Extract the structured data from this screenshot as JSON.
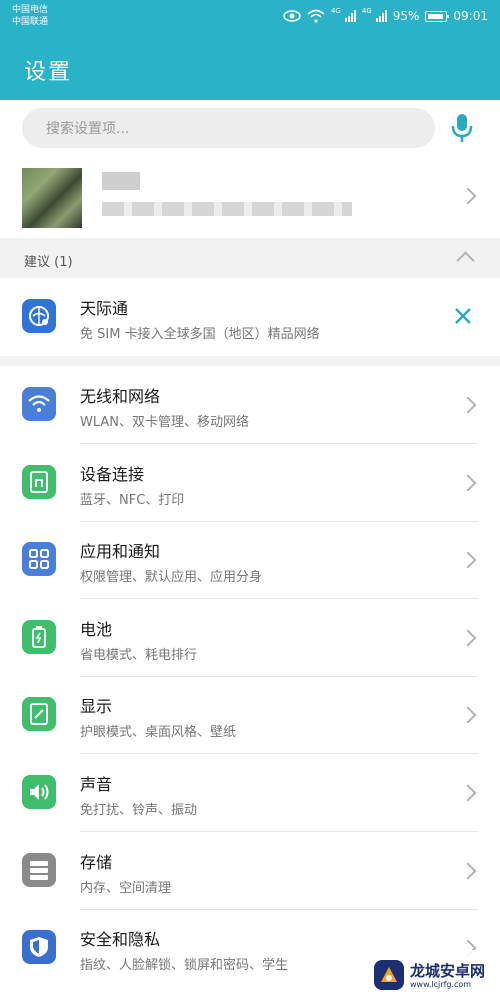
{
  "status_bar": {
    "carrier1": "中国电信",
    "carrier2": "中国联通",
    "net1": "4G",
    "net2": "4G",
    "battery": "95%",
    "time": "09:01"
  },
  "header": {
    "title": "设置"
  },
  "search": {
    "placeholder": "搜索设置项..."
  },
  "suggestions": {
    "label": "建议 (1)",
    "item": {
      "title": "天际通",
      "subtitle": "免 SIM 卡接入全球多国（地区）精品网络"
    }
  },
  "settings": [
    {
      "title": "无线和网络",
      "subtitle": "WLAN、双卡管理、移动网络",
      "icon": "wifi-icon",
      "color": "#4a7fd9"
    },
    {
      "title": "设备连接",
      "subtitle": "蓝牙、NFC、打印",
      "icon": "device-connect-icon",
      "color": "#3fbf6c"
    },
    {
      "title": "应用和通知",
      "subtitle": "权限管理、默认应用、应用分身",
      "icon": "apps-icon",
      "color": "#4a7fd9"
    },
    {
      "title": "电池",
      "subtitle": "省电模式、耗电排行",
      "icon": "battery-icon",
      "color": "#3fbf6c"
    },
    {
      "title": "显示",
      "subtitle": "护眼模式、桌面风格、壁纸",
      "icon": "display-icon",
      "color": "#3fbf6c"
    },
    {
      "title": "声音",
      "subtitle": "免打扰、铃声、振动",
      "icon": "sound-icon",
      "color": "#3fbf6c"
    },
    {
      "title": "存储",
      "subtitle": "内存、空间清理",
      "icon": "storage-icon",
      "color": "#8a8a8a"
    },
    {
      "title": "安全和隐私",
      "subtitle": "指纹、人脸解锁、锁屏和密码、学生",
      "icon": "shield-icon",
      "color": "#3a6fd0"
    }
  ],
  "watermark": {
    "name": "龙城安卓网",
    "url": "www.lcjrfg.com"
  }
}
